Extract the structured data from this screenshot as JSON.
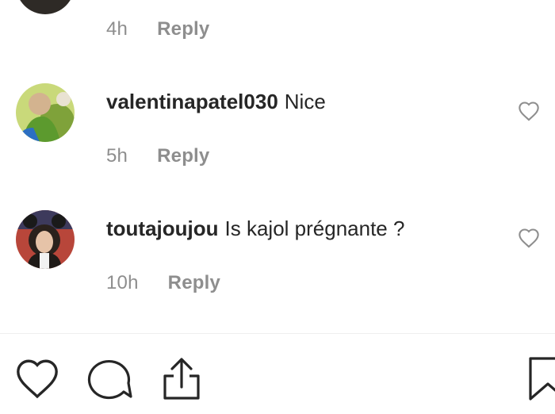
{
  "prev_comment": {
    "time": "4h",
    "reply_label": "Reply"
  },
  "comments": [
    {
      "username": "valentinapatel030",
      "text": "Nice",
      "time": "5h",
      "reply_label": "Reply"
    },
    {
      "username": "toutajoujou",
      "text": "Is kajol prégnante ?",
      "time": "10h",
      "reply_label": "Reply"
    }
  ],
  "action_bar": {
    "icons": [
      "heart-icon",
      "comment-icon",
      "share-icon",
      "bookmark-icon"
    ]
  },
  "colors": {
    "text": "#262626",
    "muted": "#8e8e8e",
    "divider": "#efefef"
  }
}
